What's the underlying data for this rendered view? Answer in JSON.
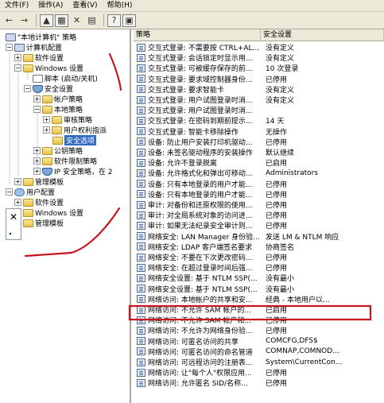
{
  "menu": [
    "文件(F)",
    "操作(A)",
    "查看(V)",
    "帮助(H)"
  ],
  "toolbar": {
    "buttons": [
      "back-icon",
      "forward-icon",
      "up-icon",
      "show-tree-icon",
      "delete-icon",
      "properties-icon",
      "help-icon",
      "console-icon"
    ]
  },
  "tree": {
    "root": "\"本地计算机\" 策略",
    "computer_config": "计算机配置",
    "software_settings": "软件设置",
    "windows_settings": "Windows 设置",
    "scripts": "脚本 (启动/关机)",
    "security_settings": "安全设置",
    "account_policy": "帐户策略",
    "local_policy": "本地策略",
    "audit_policy": "审核策略",
    "user_rights": "用户权利指派",
    "security_options": "安全选项",
    "public_key": "公钥策略",
    "software_restriction": "软件限制策略",
    "ip_security": "IP 安全策略，在 2",
    "admin_templates": "管理模板",
    "user_config": "用户配置",
    "u_software_settings": "软件设置",
    "u_windows_settings": "Windows 设置",
    "u_admin_templates": "管理模板"
  },
  "side_panel": {
    "close": "✕"
  },
  "list": {
    "col_policy": "策略",
    "col_setting": "安全设置",
    "rows": [
      {
        "policy": "交互式登录: 不需要按 CTRL+AL...",
        "setting": "没有定义"
      },
      {
        "policy": "交互式登录: 会话锁定时显示用...",
        "setting": "没有定义"
      },
      {
        "policy": "交互式登录: 可被缓存保存的前...",
        "setting": "10 次登录"
      },
      {
        "policy": "交互式登录: 要求域控制器身份...",
        "setting": "已停用"
      },
      {
        "policy": "交互式登录: 要求智能卡",
        "setting": "没有定义"
      },
      {
        "policy": "交互式登录: 用户试图登录时消...",
        "setting": "没有定义"
      },
      {
        "policy": "交互式登录: 用户试图登录时消...",
        "setting": ""
      },
      {
        "policy": "交互式登录: 在密码到期前提示...",
        "setting": "14 天"
      },
      {
        "policy": "交互式登录: 智能卡移除操作",
        "setting": "无操作"
      },
      {
        "policy": "设备: 防止用户安装打印机驱动...",
        "setting": "已停用"
      },
      {
        "policy": "设备: 未签名驱动程序的安装操作",
        "setting": "默认继续"
      },
      {
        "policy": "设备: 允许不登录脱离",
        "setting": "已启用"
      },
      {
        "policy": "设备: 允许格式化和弹出可移动...",
        "setting": "Administrators"
      },
      {
        "policy": "设备: 只有本地登录的用户才能...",
        "setting": "已停用"
      },
      {
        "policy": "设备: 只有本地登录的用户才能...",
        "setting": "已停用"
      },
      {
        "policy": "审计: 对备份和还原权限的使用...",
        "setting": "已停用"
      },
      {
        "policy": "审计: 对全局系统对象的访问进...",
        "setting": "已停用"
      },
      {
        "policy": "审计: 如果无法纪录安全审计则...",
        "setting": "已停用"
      },
      {
        "policy": "网络安全: LAN Manager 身份验...",
        "setting": "发送 LM & NTLM 响应"
      },
      {
        "policy": "网络安全: LDAP 客户端签名要求",
        "setting": "协商签名"
      },
      {
        "policy": "网络安全: 不要在下次更改密码...",
        "setting": "已停用"
      },
      {
        "policy": "网络安全: 在超过登录时间后强...",
        "setting": "已停用"
      },
      {
        "policy": "网络安全设置: 基于 NTLM SSP(...",
        "setting": "没有最小"
      },
      {
        "policy": "网络安全设置: 基于 NTLM SSP(...",
        "setting": "没有最小"
      },
      {
        "policy": "网络访问: 本地帐户的共享和安...",
        "setting": "经典 - 本地用户以..."
      },
      {
        "policy": "网络访问: 不允许 SAM 帐户的...",
        "setting": "已启用"
      },
      {
        "policy": "网络访问: 不允许 SAM 帐户和...",
        "setting": "已停用"
      },
      {
        "policy": "网络访问: 不允许为网络身份验...",
        "setting": "已停用"
      },
      {
        "policy": "网络访问: 可匿名访问的共享",
        "setting": "COMCFG,DFS$"
      },
      {
        "policy": "网络访问: 可匿名访问的命名管道",
        "setting": "COMNAP,COMNOD..."
      },
      {
        "policy": "网络访问: 可远程访问的注册表...",
        "setting": "System\\CurrentCon..."
      },
      {
        "policy": "网络访问: 让\"每个人\"权限应用...",
        "setting": "已停用"
      },
      {
        "policy": "网络访问: 允许匿名 SID/名称...",
        "setting": "已停用"
      }
    ]
  },
  "colors": {
    "menubar": "#ece9d8",
    "selection": "#316ac5",
    "annotation": "#c8161d"
  }
}
